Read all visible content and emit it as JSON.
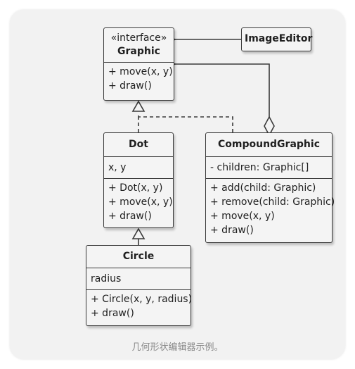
{
  "interface_box": {
    "stereotype": "«interface»",
    "name": "Graphic",
    "methods": [
      "+ move(x, y)",
      "+ draw()"
    ]
  },
  "image_editor_box": {
    "name": "ImageEditor"
  },
  "dot_box": {
    "name": "Dot",
    "fields": [
      "x, y"
    ],
    "methods": [
      "+ Dot(x, y)",
      "+ move(x, y)",
      "+ draw()"
    ]
  },
  "compound_box": {
    "name": "CompoundGraphic",
    "fields": [
      "- children: Graphic[]"
    ],
    "methods": [
      "+ add(child: Graphic)",
      "+ remove(child: Graphic)",
      "+ move(x, y)",
      "+ draw()"
    ]
  },
  "circle_box": {
    "name": "Circle",
    "fields": [
      "radius"
    ],
    "methods": [
      "+ Circle(x, y, radius)",
      "+ draw()"
    ]
  },
  "caption": "几何形状编辑器示例。",
  "colors": {
    "line": "#3a3a3a",
    "box_fill": "#f4f4f4",
    "card": "#f2f2f2",
    "caption": "#8a8a8a"
  }
}
